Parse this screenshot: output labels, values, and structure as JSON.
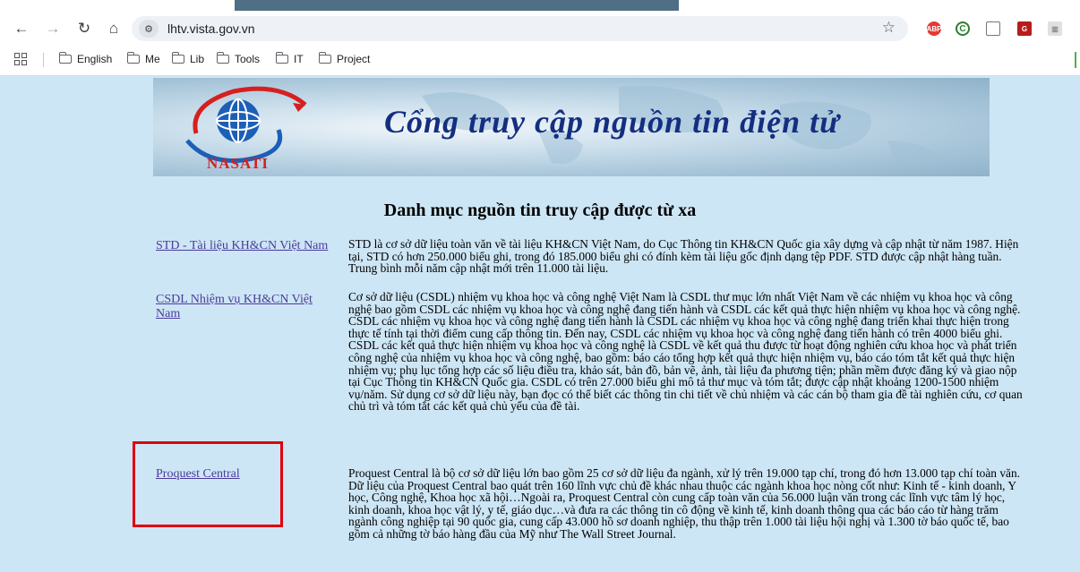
{
  "browser": {
    "url": "lhtv.vista.gov.vn",
    "bookmarks": [
      "English",
      "Me",
      "Lib",
      "Tools",
      "IT",
      "Project"
    ],
    "extensions": {
      "abp": "ABP"
    }
  },
  "banner": {
    "title": "Cổng truy cập nguồn tin điện tử",
    "logo": "NASATI"
  },
  "page": {
    "heading": "Danh mục nguồn tin truy cập được từ xa",
    "resources": [
      {
        "name": "STD - Tài liệu KH&CN Việt Nam",
        "description": "STD là cơ sở dữ liệu toàn văn về tài liệu KH&CN Việt Nam, do Cục Thông tin KH&CN Quốc gia xây dựng và cập nhật từ năm 1987. Hiện tại, STD có hơn 250.000 biểu ghi, trong đó 185.000 biểu ghi có đính kèm tài liệu gốc định dạng tệp PDF. STD được cập nhật hàng tuần. Trung bình mỗi năm cập nhật mới trên 11.000 tài liệu."
      },
      {
        "name": "CSDL Nhiệm vụ KH&CN Việt Nam",
        "description": "Cơ sở dữ liệu (CSDL) nhiệm vụ khoa học và công nghệ Việt Nam là CSDL thư mục lớn nhất Việt Nam về các nhiệm vụ khoa học và công nghệ bao gồm CSDL các nhiệm vụ khoa học và công nghệ đang tiến hành và CSDL các kết quả thực hiện nhiệm vụ khoa học và công nghệ. CSDL các nhiệm vụ khoa học và công nghệ đang tiến hành là CSDL các nhiệm vụ khoa học và công nghệ đang triển khai thực hiện trong thực tế tính tại thời điểm cung cấp thông tin. Đến nay, CSDL các nhiệm vụ khoa học và công nghệ đang tiến hành có trên 4000 biểu ghi. CSDL các kết quả thực hiện nhiệm vụ khoa học và công nghệ là CSDL về kết quả thu được từ hoạt động nghiên cứu khoa học và phát triển công nghệ của nhiệm vụ khoa học và công nghệ, bao gồm: báo cáo tổng hợp kết quả thực hiện nhiệm vụ, báo cáo tóm tắt kết quả thực hiện nhiệm vụ; phụ lục tổng hợp các số liệu điều tra, khảo sát, bản đồ, bản vẽ, ảnh, tài liệu đa phương tiện; phần mềm được đăng ký và giao nộp tại Cục Thông tin KH&CN Quốc gia. CSDL có trên 27.000 biểu ghi mô tả thư mục và tóm tắt; được cập nhật khoảng 1200-1500 nhiệm vụ/năm. Sử dụng cơ sở dữ liệu này, bạn đọc có thể biết các thông tin chi tiết về chủ nhiệm và các cán bộ tham gia đề tài nghiên cứu, cơ quan chủ trì và tóm tắt các kết quả chủ yếu của đề tài."
      },
      {
        "name": "Proquest Central",
        "description": "Proquest Central là bộ cơ sở dữ liệu lớn bao gồm 25 cơ sở dữ liệu đa ngành, xử lý trên 19.000 tạp chí, trong đó hơn 13.000 tạp chí toàn văn. Dữ liệu của Proquest Central bao quát trên 160 lĩnh vực chủ đề khác nhau thuộc các ngành khoa học nòng cốt như: Kinh tế - kinh doanh, Y học, Công nghệ, Khoa học xã hội…Ngoài ra, Proquest Central còn cung cấp toàn văn của 56.000 luận văn trong các lĩnh vực tâm lý học, kinh doanh, khoa học vật lý, y tế, giáo dục…và đưa ra các thông tin cô động về kinh tế, kinh doanh thông qua các báo cáo từ hàng trăm ngành công nghiệp tại 90 quốc gia, cung cấp 43.000 hồ sơ doanh nghiệp, thu thập trên 1.000 tài liệu hội nghị và 1.300 tờ báo quốc tế, bao gồm cả những tờ báo hàng đầu của Mỹ như The Wall Street Journal."
      }
    ]
  },
  "colors": {
    "page_bg": "#cde6f5",
    "link": "#4b3a9c",
    "banner_title": "#142e80",
    "highlight": "#e0000d"
  }
}
